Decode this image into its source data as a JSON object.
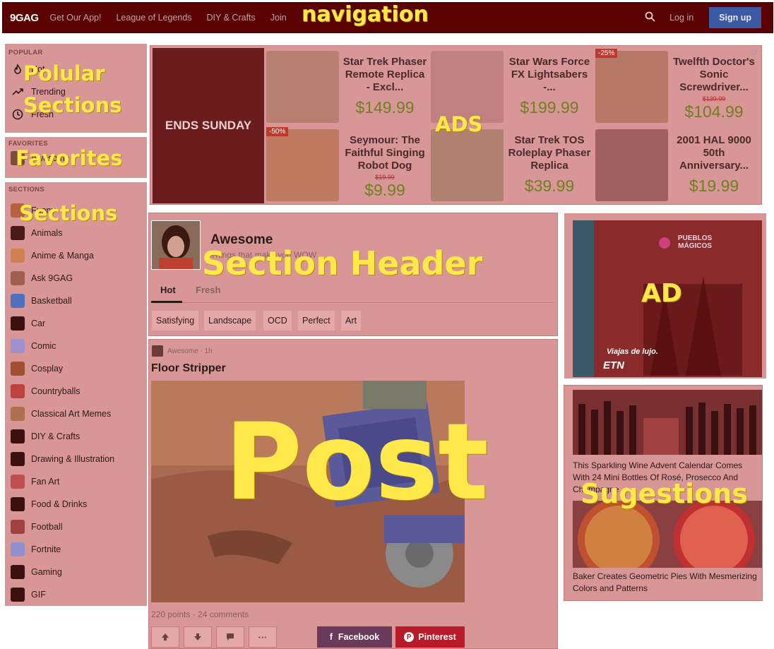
{
  "nav": {
    "logo": "9GAG",
    "links": [
      "Get Our App!",
      "League of Legends",
      "DIY & Crafts",
      "Join"
    ],
    "login": "Log in",
    "signup": "Sign up"
  },
  "annotations": {
    "navigation": "navigation",
    "popular": "Polular",
    "popular2": "Sections",
    "favorites": "Favorites",
    "sections": "Sections",
    "ads": "ADS",
    "section_header": "Section Header",
    "ad": "AD",
    "post": "Post",
    "suggestions": "Sugestions"
  },
  "sidebar": {
    "popular_heading": "POPULAR",
    "popular": [
      {
        "label": "Hot",
        "icon": "fire-icon"
      },
      {
        "label": "Trending",
        "icon": "trending-icon"
      },
      {
        "label": "Fresh",
        "icon": "clock-icon"
      }
    ],
    "favorites_heading": "FAVORITES",
    "favorites": [
      {
        "label": "Awesome"
      }
    ],
    "sections_heading": "SECTIONS",
    "sections": [
      {
        "label": "Funny",
        "color": "#b86040"
      },
      {
        "label": "Animals",
        "color": "#4a1a1a"
      },
      {
        "label": "Anime & Manga",
        "color": "#d08050"
      },
      {
        "label": "Ask 9GAG",
        "color": "#a06050"
      },
      {
        "label": "Basketball",
        "color": "#5070c0"
      },
      {
        "label": "Car",
        "color": "#3a1010"
      },
      {
        "label": "Comic",
        "color": "#a090d0"
      },
      {
        "label": "Cosplay",
        "color": "#a05030"
      },
      {
        "label": "Countryballs",
        "color": "#c04040"
      },
      {
        "label": "Classical Art Memes",
        "color": "#b07050"
      },
      {
        "label": "DIY & Crafts",
        "color": "#3a1010"
      },
      {
        "label": "Drawing & Illustration",
        "color": "#3a1010"
      },
      {
        "label": "Fan Art",
        "color": "#c05050"
      },
      {
        "label": "Food & Drinks",
        "color": "#3a1010"
      },
      {
        "label": "Football",
        "color": "#a04040"
      },
      {
        "label": "Fortnite",
        "color": "#9090d0"
      },
      {
        "label": "Gaming",
        "color": "#3a1010"
      },
      {
        "label": "GIF",
        "color": "#3a1010"
      }
    ]
  },
  "ad_banner": {
    "ends": "ENDS SUNDAY",
    "products": [
      {
        "name": "Star Trek Phaser Remote Replica - Excl...",
        "price": "$149.99",
        "old": "",
        "discount": ""
      },
      {
        "name": "Star Wars Force FX Lightsabers -...",
        "price": "$199.99",
        "old": "",
        "discount": ""
      },
      {
        "name": "Twelfth Doctor's Sonic Screwdriver...",
        "price": "$104.99",
        "old": "$139.99",
        "discount": "-25%"
      },
      {
        "name": "Seymour: The Faithful Singing Robot Dog",
        "price": "$9.99",
        "old": "$19.99",
        "discount": "-50%"
      },
      {
        "name": "Star Trek TOS Roleplay Phaser Replica",
        "price": "$39.99",
        "old": "",
        "discount": ""
      },
      {
        "name": "2001 HAL 9000 50th Anniversary...",
        "price": "$19.99",
        "old": "",
        "discount": ""
      }
    ]
  },
  "section_header": {
    "title": "Awesome",
    "subtitle": "Things that make you WOW",
    "tabs": [
      "Hot",
      "Fresh"
    ],
    "tags": [
      "Satisfying",
      "Landscape",
      "OCD",
      "Perfect",
      "Art"
    ]
  },
  "post": {
    "meta": "Awesome · 1h",
    "title": "Floor Stripper",
    "stats": "220 points · 24 comments",
    "facebook": "Facebook",
    "pinterest": "Pinterest"
  },
  "right_ad": {
    "brand": "PUEBLOS MÁGICOS",
    "tagline": "Viajas de lujo.",
    "logo": "ETN"
  },
  "suggestions": [
    {
      "text": "This Sparkling Wine Advent Calendar Comes With 24 Mini Bottles Of Rosé, Prosecco And Champagne"
    },
    {
      "text": "Baker Creates Geometric Pies With Mesmerizing Colors and Patterns"
    }
  ]
}
